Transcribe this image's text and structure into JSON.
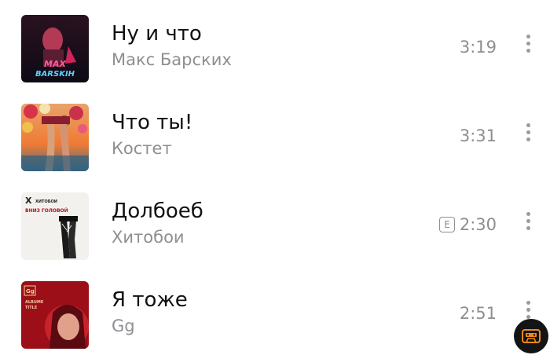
{
  "tracks": [
    {
      "title": "Ну и что",
      "artist": "Макс Барских",
      "duration": "3:19",
      "explicit": false,
      "cover_icon": "album-cover-max-barskih",
      "cover_text": "МАХ\nBARSKIH"
    },
    {
      "title": "Что ты!",
      "artist": "Костет",
      "duration": "3:31",
      "explicit": false,
      "cover_icon": "album-cover-beach-legs",
      "cover_text": ""
    },
    {
      "title": "Долбоеб",
      "artist": "Хитобои",
      "duration": "2:30",
      "explicit": true,
      "explicit_label": "E",
      "cover_icon": "album-cover-vniz-golovoy",
      "cover_text": "Х   ХИТОБОИ\nВНИЗ ГОЛОВОЙ"
    },
    {
      "title": "Я тоже",
      "artist": "Gg",
      "duration": "2:51",
      "explicit": false,
      "cover_icon": "album-cover-gg-red",
      "cover_text": "Gg\nALBUME\nTITLE"
    }
  ],
  "colors": {
    "title": "#111111",
    "secondary": "#8e8e93",
    "fab_background": "#141414",
    "fab_icon": "#f08a1c"
  },
  "fab_icon": "cassette-icon"
}
